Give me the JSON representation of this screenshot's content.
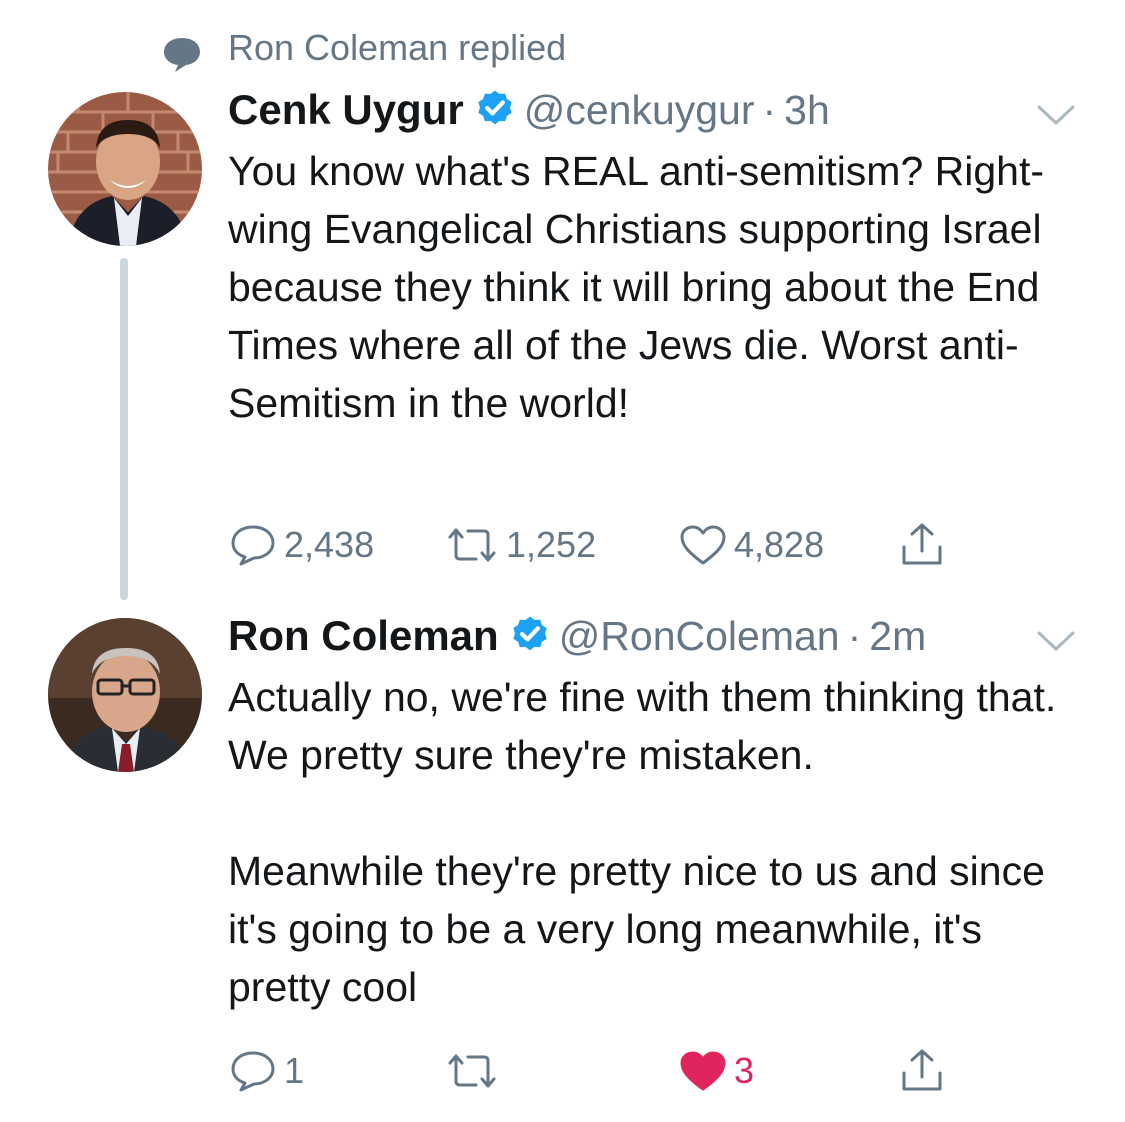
{
  "context": {
    "text": "Ron Coleman replied",
    "icon": "speech-bubble-icon"
  },
  "tweets": [
    {
      "display_name": "Cenk Uygur",
      "verified": true,
      "handle": "@cenkuygur",
      "separator": "·",
      "time": "3h",
      "text": [
        "You know what's REAL anti-semitism? Right-wing Evangelical Christians supporting Israel because they think it will bring about the End Times where all of the Jews die. Worst anti-Semitism in the world!"
      ],
      "actions": {
        "reply_count": "2,438",
        "retweet_count": "1,252",
        "like_count": "4,828",
        "liked": false
      }
    },
    {
      "display_name": "Ron Coleman",
      "verified": true,
      "handle": "@RonColeman",
      "separator": "·",
      "time": "2m",
      "text": [
        "Actually no, we're fine with them thinking that. We pretty sure they're mistaken.",
        "Meanwhile they're pretty nice to us and since it's going to be a very long meanwhile, it's pretty cool"
      ],
      "actions": {
        "reply_count": "1",
        "retweet_count": "",
        "like_count": "3",
        "liked": true
      }
    }
  ],
  "colors": {
    "verified_blue": "#1da1f2",
    "secondary_text": "#657786",
    "like_red": "#e0245e",
    "thread_line": "#ccd6dd"
  }
}
